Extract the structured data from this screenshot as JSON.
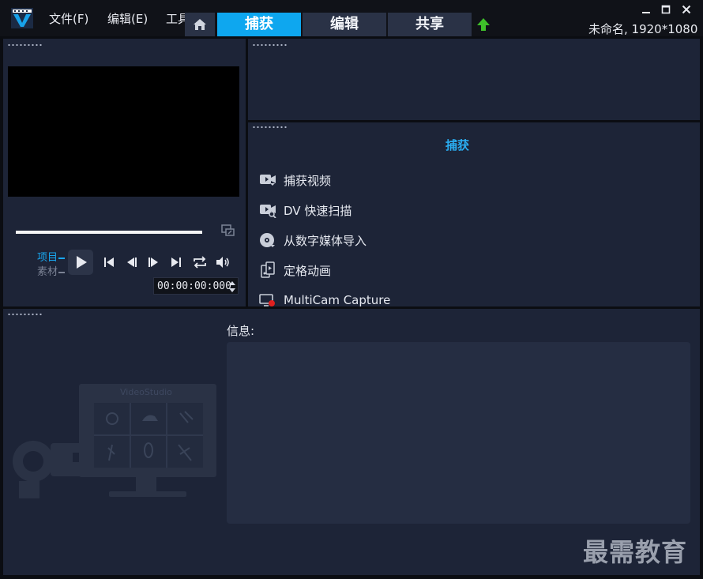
{
  "menu": {
    "file": "文件(F)",
    "edit": "编辑(E)",
    "tools": "工具"
  },
  "tabs": {
    "capture": "捕获",
    "edit": "编辑",
    "share": "共享"
  },
  "project_info": "未命名, 1920*1080",
  "player": {
    "mode_project": "项目",
    "mode_clip": "素材",
    "timecode": "00:00:00:000"
  },
  "capture": {
    "title": "捕获",
    "items": [
      {
        "label": "捕获视频",
        "icon": "capture-video-icon"
      },
      {
        "label": "DV 快速扫描",
        "icon": "dv-scan-icon"
      },
      {
        "label": "从数字媒体导入",
        "icon": "disc-import-icon"
      },
      {
        "label": "定格动画",
        "icon": "stop-motion-icon"
      },
      {
        "label": "MultiCam Capture",
        "icon": "multicam-icon"
      }
    ]
  },
  "info": {
    "label": "信息:"
  },
  "illustration": {
    "brand": "VideoStudio"
  },
  "watermark": "最需教育",
  "colors": {
    "accent": "#0ea7ef",
    "panel": "#1d2437",
    "upload_arrow": "#3fbf2a"
  }
}
